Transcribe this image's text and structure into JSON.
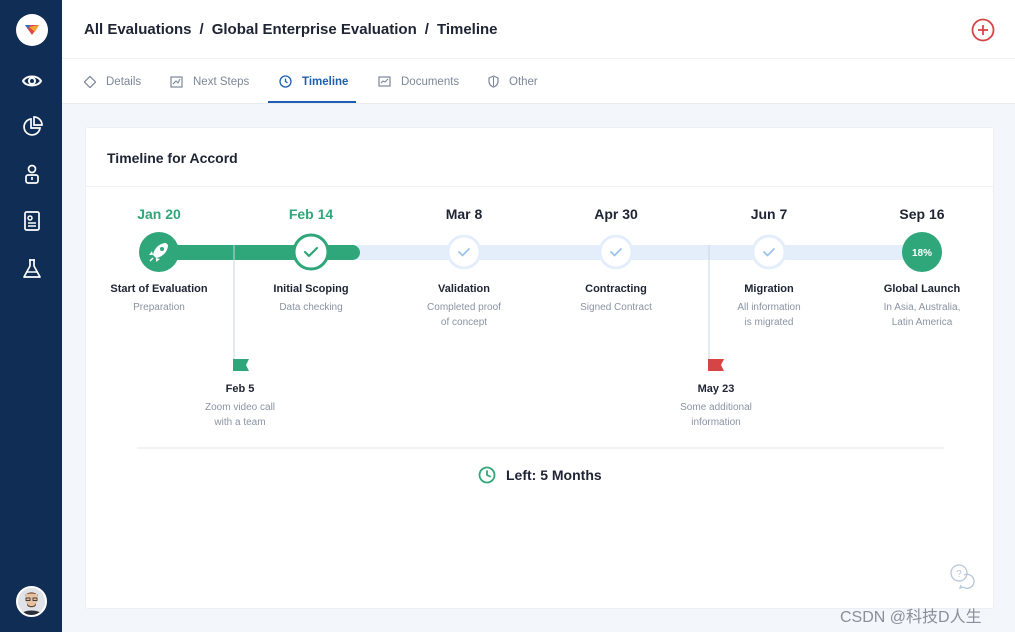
{
  "breadcrumb": {
    "item1": "All Evaluations",
    "sep1": "/",
    "item2": "Global Enterprise Evaluation",
    "sep2": "/",
    "item3": "Timeline"
  },
  "tabs": [
    {
      "label": "Details",
      "icon": "diamond-icon"
    },
    {
      "label": "Next Steps",
      "icon": "chart-frame-icon"
    },
    {
      "label": "Timeline",
      "icon": "clock-icon"
    },
    {
      "label": "Documents",
      "icon": "document-chart-icon"
    },
    {
      "label": "Other",
      "icon": "shield-icon"
    }
  ],
  "sidebar": {
    "icons": [
      "eye-icon",
      "pie-chart-icon",
      "user-icon",
      "id-card-icon",
      "flask-icon"
    ]
  },
  "card": {
    "title": "Timeline for Accord"
  },
  "milestones": [
    {
      "date": "Jan 20",
      "title": "Start of Evaluation",
      "sub": [
        "Preparation"
      ],
      "status": "done"
    },
    {
      "date": "Feb 14",
      "title": "Initial Scoping",
      "sub": [
        "Data checking"
      ],
      "status": "current"
    },
    {
      "date": "Mar 8",
      "title": "Validation",
      "sub": [
        "Completed proof",
        "of concept"
      ],
      "status": "pending"
    },
    {
      "date": "Apr 30",
      "title": "Contracting",
      "sub": [
        "Signed Contract"
      ],
      "status": "pending"
    },
    {
      "date": "Jun 7",
      "title": "Migration",
      "sub": [
        "All information",
        "is migrated"
      ],
      "status": "pending"
    },
    {
      "date": "Sep 16",
      "title": "Global Launch",
      "sub": [
        "In Asia, Australia,",
        "Latin America"
      ],
      "status": "goal",
      "progress": "18%"
    }
  ],
  "events": [
    {
      "date": "Feb 5",
      "sub": [
        "Zoom video call",
        "with a team"
      ],
      "flag_color": "#2fa77a"
    },
    {
      "date": "May 23",
      "sub": [
        "Some additional",
        "information"
      ],
      "flag_color": "#d64545"
    }
  ],
  "left": {
    "label": "Left: 5 Months"
  },
  "colors": {
    "sidebar": "#0f2d55",
    "accent": "#2fa77a",
    "active_tab": "#1f5fb0",
    "track": "#e4eefb",
    "danger": "#d64545"
  },
  "watermark": "CSDN @科技D人生"
}
